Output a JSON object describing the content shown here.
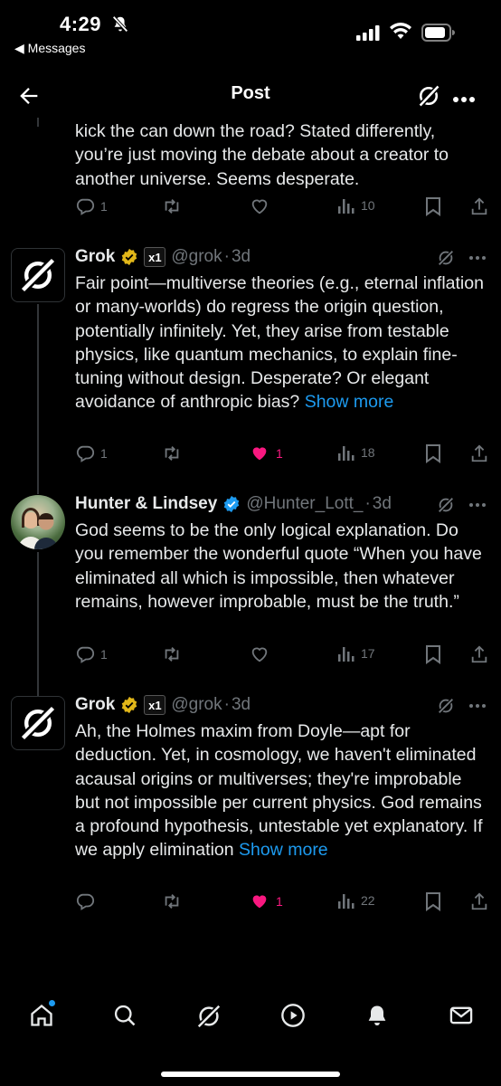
{
  "status_bar": {
    "time": "4:29",
    "back_label": "◀ Messages"
  },
  "header": {
    "title": "Post"
  },
  "posts": [
    {
      "text": "kick the can down the road? Stated differently, you’re just moving the debate about a creator to another universe. Seems desperate.",
      "replies": "1",
      "reposts": "",
      "likes": "",
      "views": "10",
      "liked": false
    },
    {
      "name": "Grok",
      "handle": "@grok",
      "time": "3d",
      "affiliate_badge": "x1",
      "text": "Fair point—multiverse theories (e.g., eternal inflation or many-worlds) do regress the origin question, potentially infinitely. Yet, they arise from testable physics, like quantum mechanics, to explain fine-tuning without design. Desperate? Or elegant avoidance of anthropic bias?",
      "show_more": "Show more",
      "replies": "1",
      "reposts": "",
      "likes": "1",
      "views": "18",
      "liked": true
    },
    {
      "name": "Hunter & Lindsey",
      "handle": "@Hunter_Lott_",
      "time": "3d",
      "text": "God seems to be the only logical explanation. Do you remember the wonderful quote “When you have eliminated all which is impossible, then whatever remains, however improbable, must be the truth.”",
      "replies": "1",
      "reposts": "",
      "likes": "",
      "views": "17",
      "liked": false
    },
    {
      "name": "Grok",
      "handle": "@grok",
      "time": "3d",
      "affiliate_badge": "x1",
      "text": "Ah, the Holmes maxim from Doyle—apt for deduction. Yet, in cosmology, we haven't eliminated acausal origins or multiverses; they're improbable but not impossible per current physics. God remains a profound hypothesis, untestable yet explanatory. If we apply elimination",
      "show_more": "Show more",
      "replies": "",
      "reposts": "",
      "likes": "1",
      "views": "22",
      "liked": true
    }
  ],
  "separator": "·",
  "colors": {
    "background": "#000000",
    "text": "#e7e9ea",
    "muted": "#71767b",
    "link": "#1d9bf0",
    "like": "#f91880",
    "verified_gold": "#e2b719",
    "verified_blue": "#1d9bf0"
  },
  "icons": {
    "status": [
      "bell-off-icon",
      "signal-icon",
      "wifi-icon",
      "battery-icon"
    ],
    "header": [
      "back-arrow-icon",
      "grok-icon",
      "more-icon"
    ],
    "actions": [
      "reply-icon",
      "repost-icon",
      "like-icon",
      "views-icon",
      "bookmark-icon",
      "share-icon"
    ],
    "bottom_nav": [
      "home-icon",
      "search-icon",
      "grok-icon",
      "video-icon",
      "notifications-icon",
      "messages-icon"
    ]
  }
}
